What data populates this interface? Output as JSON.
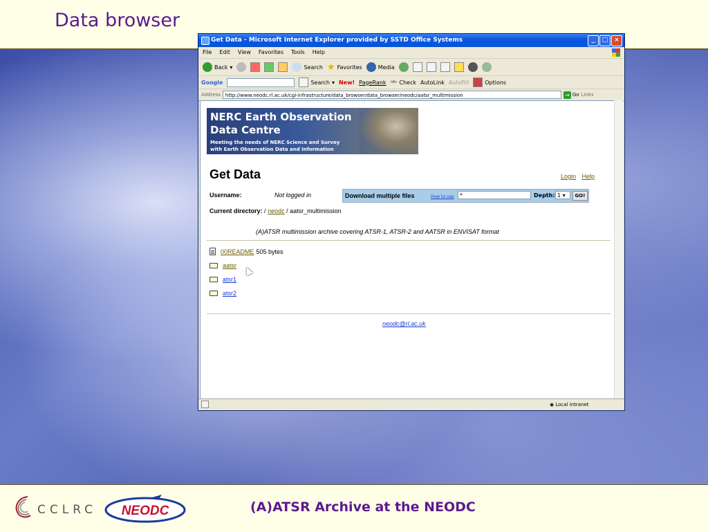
{
  "slide": {
    "title": "Data browser",
    "footer_caption": "(A)ATSR Archive at the NEODC",
    "cclrc_label": "CCLRC",
    "neodc_label": "NEODC"
  },
  "browser": {
    "title": "Get Data - Microsoft Internet Explorer provided by SSTD Office Systems",
    "menu": [
      "File",
      "Edit",
      "View",
      "Favorites",
      "Tools",
      "Help"
    ],
    "toolbar": {
      "back": "Back",
      "search": "Search",
      "favorites": "Favorites",
      "media": "Media"
    },
    "google": {
      "label": "Google",
      "search": "Search",
      "new_badge": "New!",
      "pagerank": "PageRank",
      "check": "Check",
      "autolink": "AutoLink",
      "autofill": "AutoFill",
      "options": "Options"
    },
    "address_label": "Address",
    "url": "http://www.neodc.rl.ac.uk/cgi-infrastructure/data_browser/data_browser/neodc/aatsr_multimission",
    "go": "Go",
    "links": "Links",
    "status_zone": "Local intranet"
  },
  "page": {
    "banner": {
      "line1": "NERC Earth Observation",
      "line2": "Data Centre",
      "line3": "Meeting the needs of NERC Science and Survey",
      "line4": "with Earth Observation Data and Information"
    },
    "heading": "Get Data",
    "login": "Login",
    "help": "Help",
    "username_label": "Username:",
    "username_value": "Not logged in",
    "download": {
      "label": "Download multiple files",
      "how_to_use": "How to use",
      "pattern_value": "*",
      "depth_label": "Depth:",
      "depth_value": "1",
      "go": "GO!"
    },
    "current_dir_label": "Current directory:",
    "current_dir_sep1": "/",
    "current_dir_link": "neodc",
    "current_dir_rest": "/ aatsr_multimission",
    "description": "(A)ATSR multimission archive covering ATSR-1, ATSR-2 and AATSR in ENVISAT format",
    "files": [
      {
        "name": "00README",
        "size": "505 bytes",
        "type": "file"
      },
      {
        "name": "aatsr",
        "type": "folder"
      },
      {
        "name": "atsr1",
        "type": "folder"
      },
      {
        "name": "atsr2",
        "type": "folder"
      }
    ],
    "contact_email": "neodc@rl.ac.uk"
  }
}
